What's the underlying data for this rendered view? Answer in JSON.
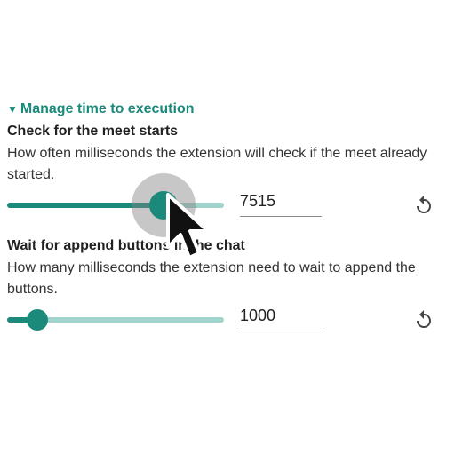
{
  "section": {
    "caret": "▼",
    "label": "Manage time to execution"
  },
  "settings": [
    {
      "title": "Check for the meet starts",
      "description": "How often milliseconds the extension will check if the meet already started.",
      "value": "7515",
      "slider_fraction": 0.72,
      "active": true
    },
    {
      "title": "Wait for append buttons in the chat",
      "description": "How many milliseconds the extension need to wait to append the buttons.",
      "value": "1000",
      "slider_fraction": 0.14,
      "active": false
    }
  ],
  "colors": {
    "accent": "#1b8a7b",
    "track": "#9fd3cb",
    "text": "#222222"
  },
  "icons": {
    "reset": "reset-icon",
    "cursor": "mouse-pointer-icon",
    "caret": "triangle-down-icon"
  }
}
